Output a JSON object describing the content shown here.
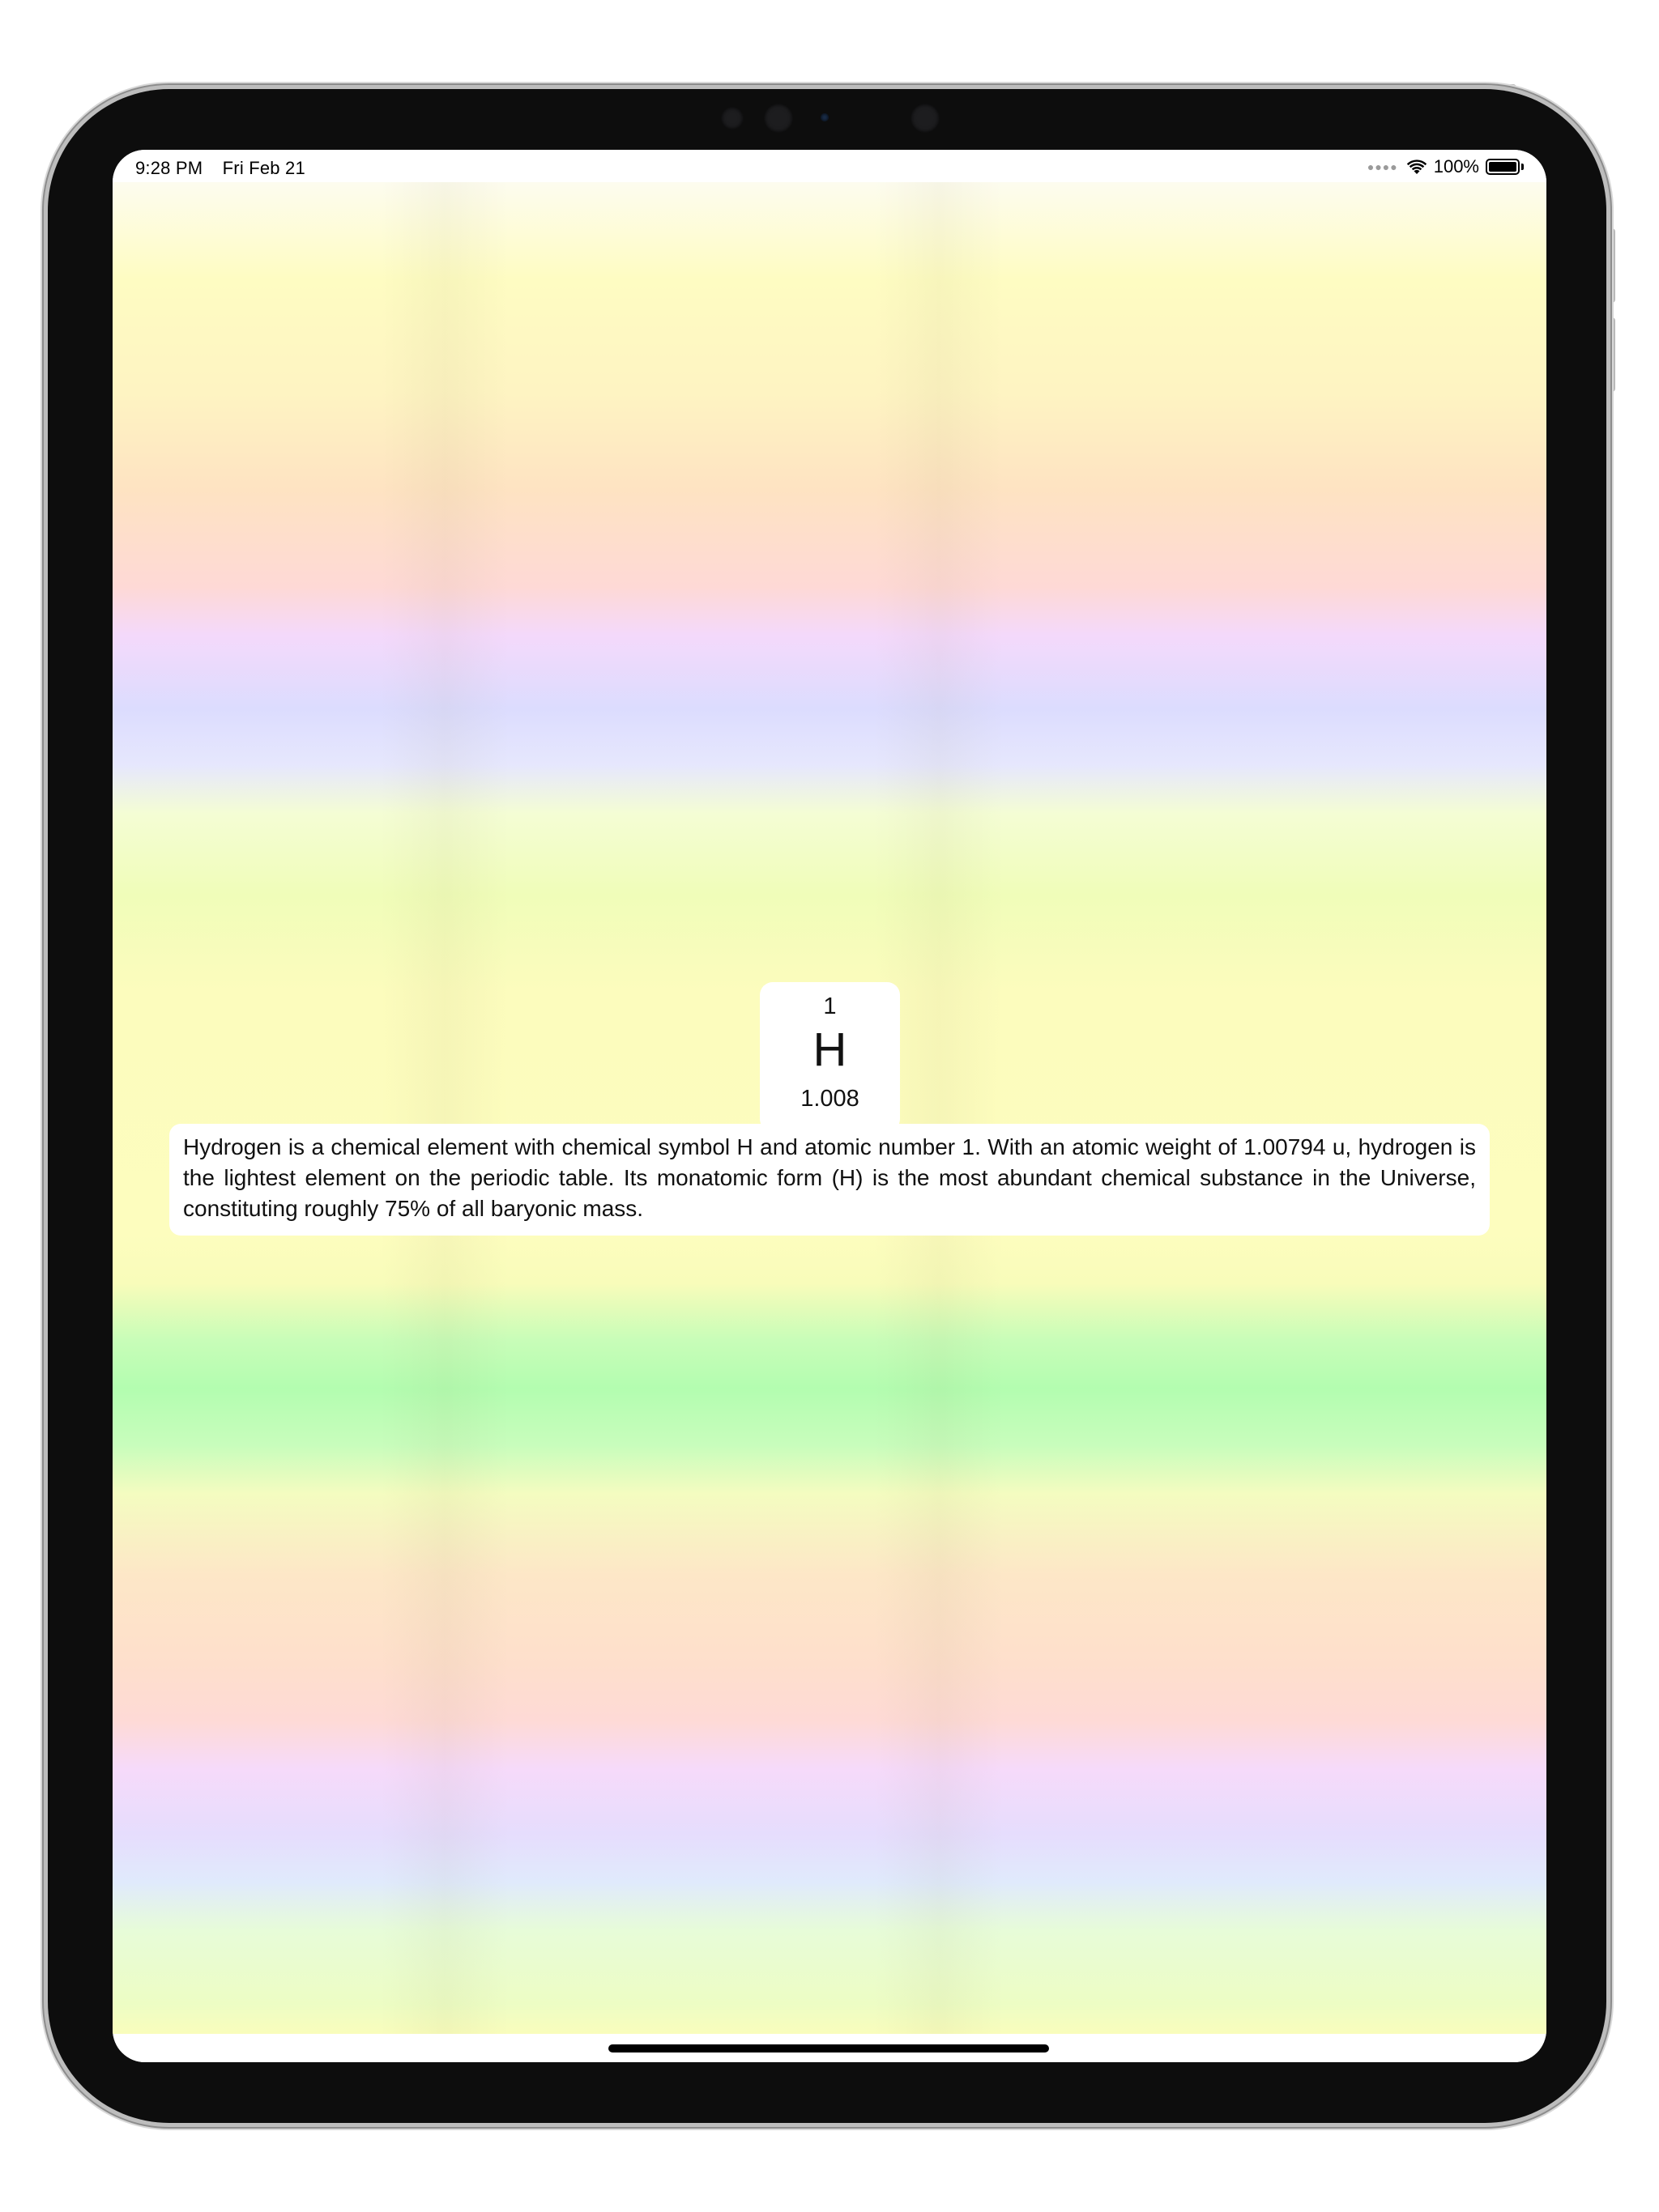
{
  "status_bar": {
    "time": "9:28 PM",
    "date": "Fri Feb 21",
    "signal_icon": "signal-dots-icon",
    "wifi_icon": "wifi-icon",
    "battery_percent": "100%",
    "battery_icon": "battery-icon",
    "battery_level": 1.0
  },
  "element": {
    "atomic_number": "1",
    "symbol": "H",
    "atomic_mass": "1.008",
    "description": "Hydrogen is a chemical element with chemical symbol H and atomic number 1. With an atomic weight of 1.00794 u, hydrogen is the lightest element on the periodic table. Its monatomic form (H) is the most abundant chemical substance in the Universe, constituting roughly 75% of all baryonic mass."
  },
  "colors": {
    "background_bands": [
      "#fefcc2",
      "#fee3c2",
      "#dcdcfe",
      "#fdfdbe",
      "#b3fdb0",
      "#fedad6",
      "#e6ddfd",
      "#f9fdbc"
    ],
    "card": "#ffffff",
    "text": "#111111"
  }
}
